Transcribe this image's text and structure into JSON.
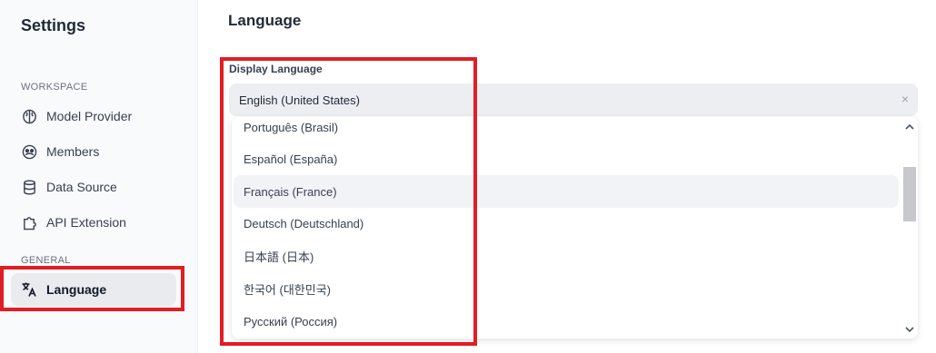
{
  "sidebar": {
    "title": "Settings",
    "workspace_label": "WORKSPACE",
    "items": [
      {
        "label": "Model Provider",
        "icon": "brain-icon"
      },
      {
        "label": "Members",
        "icon": "members-icon"
      },
      {
        "label": "Data Source",
        "icon": "database-icon"
      },
      {
        "label": "API Extension",
        "icon": "puzzle-icon"
      }
    ],
    "general_label": "GENERAL",
    "language_item": {
      "label": "Language",
      "icon": "translate-icon"
    }
  },
  "main": {
    "title": "Language",
    "field_label": "Display Language",
    "selected_value": "English (United States)",
    "clear_symbol": "×",
    "options": [
      "Português (Brasil)",
      "Español (España)",
      "Français (France)",
      "Deutsch (Deutschland)",
      "日本語 (日本)",
      "한국어 (대한민국)",
      "Русский (Россия)"
    ],
    "hovered_option": "Français (France)"
  },
  "colors": {
    "highlight": "#e11d25",
    "sidebar_bg": "#f9fafb",
    "active_item_bg": "#e9ebef",
    "select_bg": "#eceef2"
  }
}
